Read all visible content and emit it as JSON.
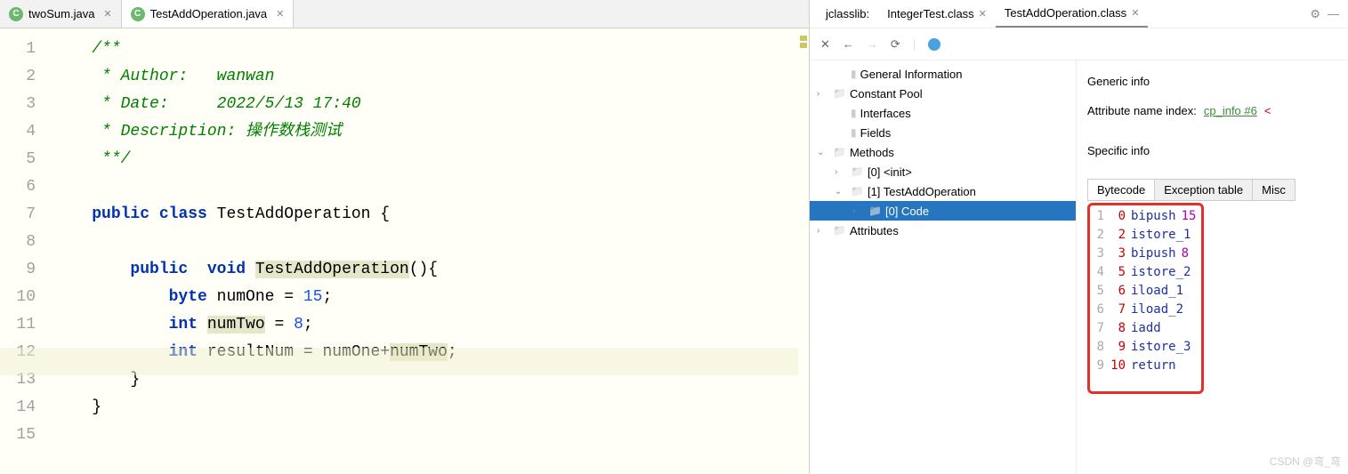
{
  "editor": {
    "tabs": [
      {
        "label": "twoSum.java",
        "active": false
      },
      {
        "label": "TestAddOperation.java",
        "active": true
      }
    ],
    "lines": [
      "1",
      "2",
      "3",
      "4",
      "5",
      "6",
      "7",
      "8",
      "9",
      "10",
      "11",
      "12",
      "13",
      "14",
      "15"
    ],
    "code": {
      "c1": "/**",
      "c2a": " * Author:   ",
      "c2b": "wanwan",
      "c3a": " * Date:     ",
      "c3b": "2022/5/13 17:40",
      "c4a": " * Description: ",
      "c4b": "操作数栈测试",
      "c5": " **/",
      "l7_public": "public ",
      "l7_class": "class ",
      "l7_name": "TestAddOperation ",
      "l7_brace": "{",
      "l9_public": "public  ",
      "l9_void": "void ",
      "l9_name": "TestAddOperation",
      "l9_paren": "(){",
      "l10_byte": "byte ",
      "l10_rest1": "numOne = ",
      "l10_num": "15",
      "l10_semi": ";",
      "l11_int": "int ",
      "l11_var": "numTwo",
      "l11_rest": " = ",
      "l11_num": "8",
      "l11_semi": ";",
      "l12_int": "int ",
      "l12_rest1": "resultNum = numOne+",
      "l12_var": "numTwo",
      "l12_semi": ";",
      "l13": "}",
      "l14": "}"
    }
  },
  "jclass": {
    "title": "jclasslib:",
    "tabs": [
      {
        "label": "IntegerTest.class",
        "active": false
      },
      {
        "label": "TestAddOperation.class",
        "active": true
      }
    ],
    "toolbar": {
      "close": "✕",
      "back": "←",
      "fwd": "→",
      "reload": "⟳"
    },
    "tree": [
      {
        "indent": 1,
        "arrow": "",
        "icon": "file",
        "label": "General Information"
      },
      {
        "indent": 0,
        "arrow": "›",
        "icon": "folder",
        "label": "Constant Pool"
      },
      {
        "indent": 1,
        "arrow": "",
        "icon": "file",
        "label": "Interfaces"
      },
      {
        "indent": 1,
        "arrow": "",
        "icon": "file",
        "label": "Fields"
      },
      {
        "indent": 0,
        "arrow": "⌄",
        "icon": "folder",
        "label": "Methods"
      },
      {
        "indent": 1,
        "arrow": "›",
        "icon": "folder",
        "label": "[0] <init>"
      },
      {
        "indent": 1,
        "arrow": "⌄",
        "icon": "folder",
        "label": "[1] TestAddOperation"
      },
      {
        "indent": 2,
        "arrow": "›",
        "icon": "folder",
        "label": "[0] Code",
        "selected": true
      },
      {
        "indent": 0,
        "arrow": "›",
        "icon": "folder",
        "label": "Attributes"
      }
    ],
    "detail": {
      "generic_title": "Generic info",
      "attr_name_label": "Attribute name index:",
      "attr_name_link": "cp_info #6",
      "specific_title": "Specific info",
      "bc_tabs": [
        "Bytecode",
        "Exception table",
        "Misc"
      ],
      "bytecode": [
        {
          "ln": "1",
          "off": "0",
          "op": "bipush",
          "arg": "15"
        },
        {
          "ln": "2",
          "off": "2",
          "op": "istore_1",
          "arg": ""
        },
        {
          "ln": "3",
          "off": "3",
          "op": "bipush",
          "arg": "8"
        },
        {
          "ln": "4",
          "off": "5",
          "op": "istore_2",
          "arg": ""
        },
        {
          "ln": "5",
          "off": "6",
          "op": "iload_1",
          "arg": ""
        },
        {
          "ln": "6",
          "off": "7",
          "op": "iload_2",
          "arg": ""
        },
        {
          "ln": "7",
          "off": "8",
          "op": "iadd",
          "arg": ""
        },
        {
          "ln": "8",
          "off": "9",
          "op": "istore_3",
          "arg": ""
        },
        {
          "ln": "9",
          "off": "10",
          "op": "return",
          "arg": ""
        }
      ]
    }
  },
  "watermark": "CSDN @弯_弯"
}
